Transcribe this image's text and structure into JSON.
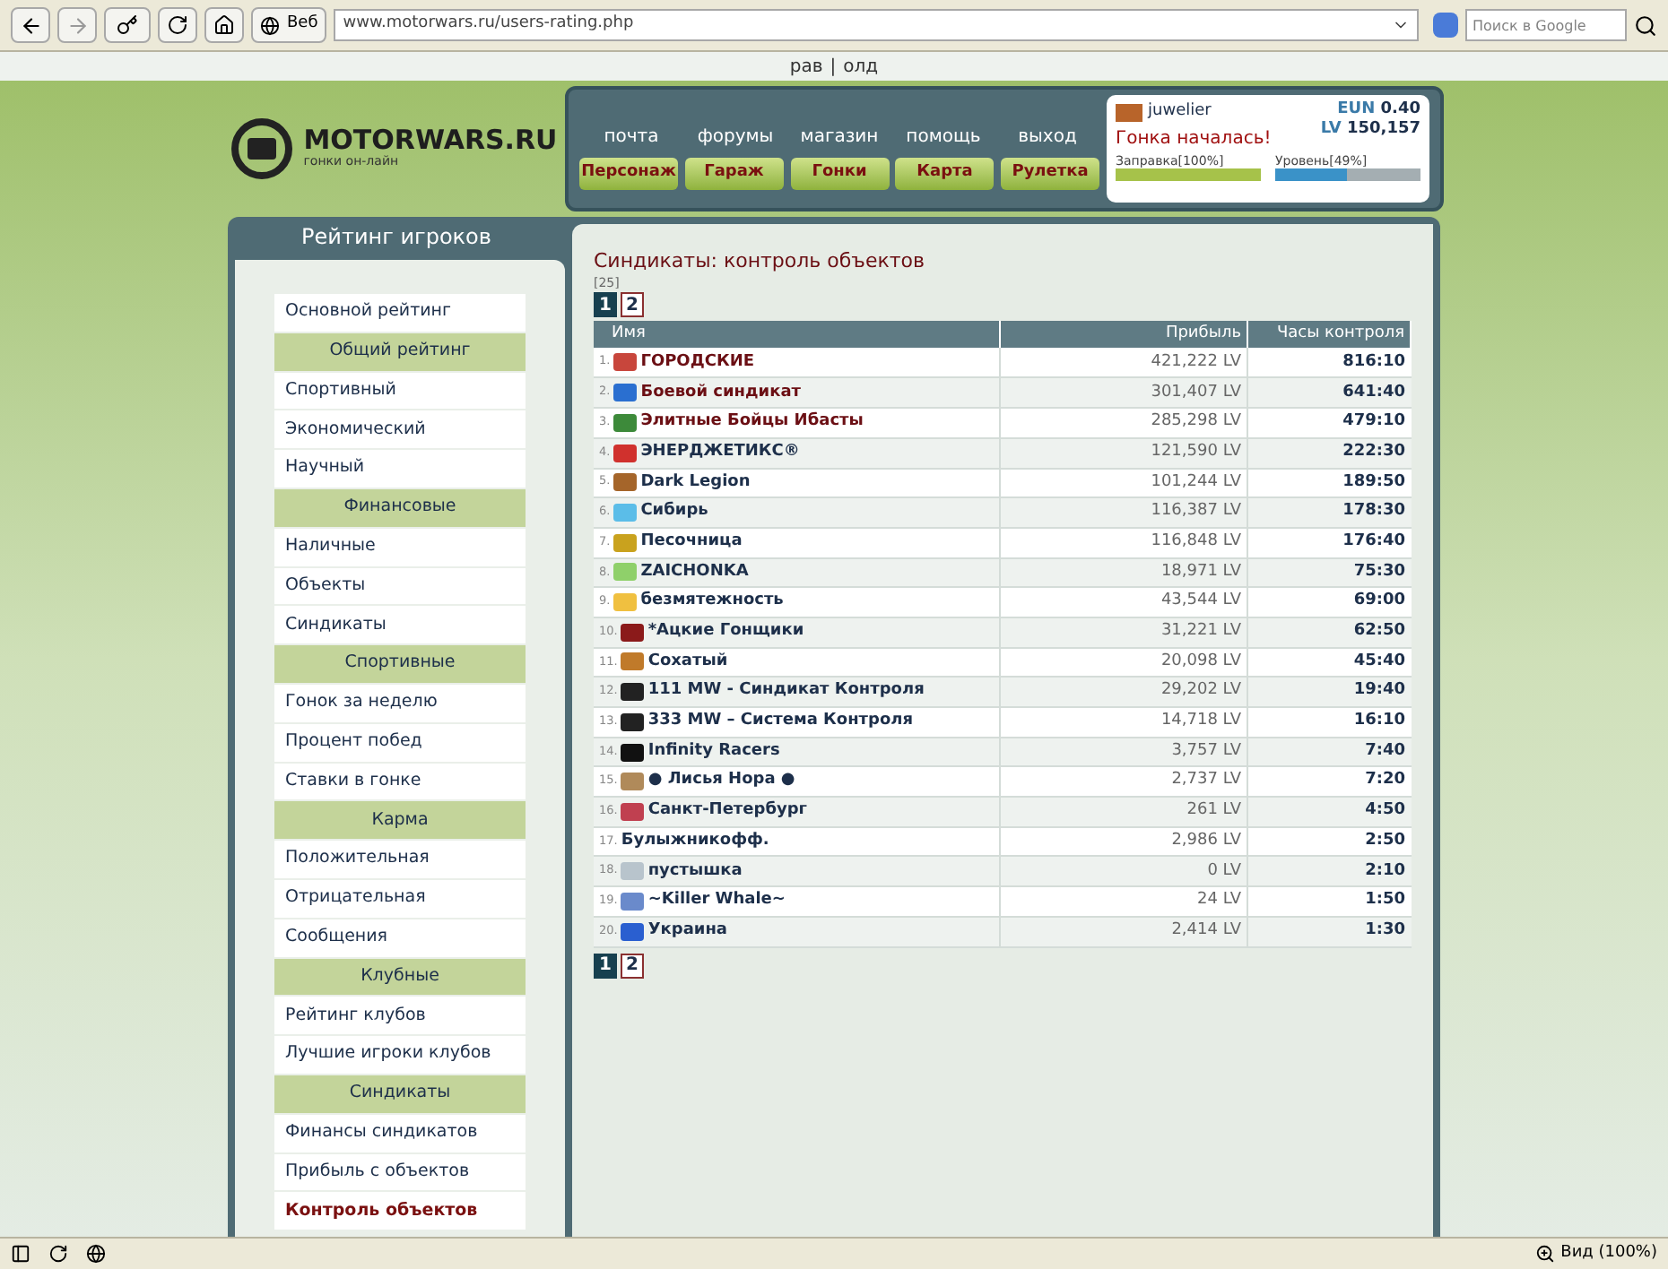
{
  "browser": {
    "tab_label": "Веб",
    "url": "www.motorwars.ru/users-rating.php",
    "search_placeholder": "Поиск в Google",
    "zoom": "Вид (100%)"
  },
  "top_links": [
    "рав",
    "олд"
  ],
  "top_separator": "|",
  "logo": {
    "name": "MOTORWARS.RU",
    "tagline": "гонки он-лайн"
  },
  "nav_links": [
    "почта",
    "форумы",
    "магазин",
    "помощь",
    "выход"
  ],
  "nav_buttons": [
    "Персонаж",
    "Гараж",
    "Гонки",
    "Карта",
    "Рулетка"
  ],
  "user": {
    "name": "juwelier",
    "status": "Гонка началась!",
    "currencies": [
      {
        "unit": "EUN",
        "amount": "0.40"
      },
      {
        "unit": "LV",
        "amount": "150,157"
      }
    ],
    "bars": [
      {
        "label": "Заправка[100%]",
        "level": 1.0,
        "kind": "fuel"
      },
      {
        "label": "Уровень[49%]",
        "level": 0.49,
        "kind": "xp"
      }
    ]
  },
  "sidebar": {
    "title": "Рейтинг игроков",
    "items": [
      {
        "kind": "link",
        "label": "Основной рейтинг",
        "selected": false
      },
      {
        "kind": "header",
        "label": "Общий рейтинг"
      },
      {
        "kind": "link",
        "label": "Спортивный",
        "selected": false
      },
      {
        "kind": "link",
        "label": "Экономический",
        "selected": false
      },
      {
        "kind": "link",
        "label": "Научный",
        "selected": false
      },
      {
        "kind": "header",
        "label": "Финансовые"
      },
      {
        "kind": "link",
        "label": "Наличные",
        "selected": false
      },
      {
        "kind": "link",
        "label": "Объекты",
        "selected": false
      },
      {
        "kind": "link",
        "label": "Синдикаты",
        "selected": false
      },
      {
        "kind": "header",
        "label": "Спортивные"
      },
      {
        "kind": "link",
        "label": "Гонок за неделю",
        "selected": false
      },
      {
        "kind": "link",
        "label": "Процент побед",
        "selected": false
      },
      {
        "kind": "link",
        "label": "Ставки в гонке",
        "selected": false
      },
      {
        "kind": "header",
        "label": "Карма"
      },
      {
        "kind": "link",
        "label": "Положительная",
        "selected": false
      },
      {
        "kind": "link",
        "label": "Отрицательная",
        "selected": false
      },
      {
        "kind": "link",
        "label": "Сообщения",
        "selected": false
      },
      {
        "kind": "header",
        "label": "Клубные"
      },
      {
        "kind": "link",
        "label": "Рейтинг клубов",
        "selected": false
      },
      {
        "kind": "link",
        "label": "Лучшие игроки клубов",
        "selected": false
      },
      {
        "kind": "header",
        "label": "Синдикаты"
      },
      {
        "kind": "link",
        "label": "Финансы синдикатов",
        "selected": false
      },
      {
        "kind": "link",
        "label": "Прибыль с объектов",
        "selected": false
      },
      {
        "kind": "link",
        "label": "Контроль объектов",
        "selected": true
      }
    ]
  },
  "content": {
    "title": "Синдикаты: контроль объектов",
    "count": "[25]",
    "pages_top": [
      {
        "label": "1",
        "selected": true
      },
      {
        "label": "2",
        "selected": false
      }
    ],
    "table": {
      "columns": [
        "Имя",
        "Прибыль",
        "Часы контроля"
      ],
      "rows": [
        {
          "rank": "1.",
          "name": "ГОРОДСКИЕ",
          "profit": "421,222 LV",
          "hours": "816:10",
          "highlighted": true,
          "color": "#c8463c"
        },
        {
          "rank": "2.",
          "name": "Боевой синдикат",
          "profit": "301,407 LV",
          "hours": "641:40",
          "highlighted": true,
          "color": "#2a6fd0"
        },
        {
          "rank": "3.",
          "name": "Элитные Бойцы Ибасты",
          "profit": "285,298 LV",
          "hours": "479:10",
          "highlighted": true,
          "color": "#3d8a3a"
        },
        {
          "rank": "4.",
          "name": "ЭНЕРДЖЕТИКС®",
          "profit": "121,590 LV",
          "hours": "222:30",
          "highlighted": false,
          "color": "#d0312d"
        },
        {
          "rank": "5.",
          "name": "Dark Legion",
          "profit": "101,244 LV",
          "hours": "189:50",
          "highlighted": false,
          "color": "#a5652a"
        },
        {
          "rank": "6.",
          "name": "Сибирь",
          "profit": "116,387 LV",
          "hours": "178:30",
          "highlighted": false,
          "color": "#5bbde8"
        },
        {
          "rank": "7.",
          "name": "Песочница",
          "profit": "116,848 LV",
          "hours": "176:40",
          "highlighted": false,
          "color": "#c9a21e"
        },
        {
          "rank": "8.",
          "name": "ZAICHONKA",
          "profit": "18,971 LV",
          "hours": "75:30",
          "highlighted": false,
          "color": "#8fd06a"
        },
        {
          "rank": "9.",
          "name": "безмятежность",
          "profit": "43,544 LV",
          "hours": "69:00",
          "highlighted": false,
          "color": "#f0c040"
        },
        {
          "rank": "10.",
          "name": "*Ацкие Гонщики",
          "profit": "31,221 LV",
          "hours": "62:50",
          "highlighted": false,
          "color": "#8b1a1a"
        },
        {
          "rank": "11.",
          "name": "Сохатый",
          "profit": "20,098 LV",
          "hours": "45:40",
          "highlighted": false,
          "color": "#c07a2a"
        },
        {
          "rank": "12.",
          "name": "111 MW - Синдикат Контроля",
          "profit": "29,202 LV",
          "hours": "19:40",
          "highlighted": false,
          "color": "#222222"
        },
        {
          "rank": "13.",
          "name": "333 MW – Система Контроля",
          "profit": "14,718 LV",
          "hours": "16:10",
          "highlighted": false,
          "color": "#222222"
        },
        {
          "rank": "14.",
          "name": "Infinity Racers",
          "profit": "3,757 LV",
          "hours": "7:40",
          "highlighted": false,
          "color": "#111111"
        },
        {
          "rank": "15.",
          "name": "● Лисья Нора ●",
          "profit": "2,737 LV",
          "hours": "7:20",
          "highlighted": false,
          "color": "#b08a5a"
        },
        {
          "rank": "16.",
          "name": "Санкт-Петербург",
          "profit": "261 LV",
          "hours": "4:50",
          "highlighted": false,
          "color": "#c04050"
        },
        {
          "rank": "17.",
          "name": "Булыжникофф.",
          "profit": "2,986 LV",
          "hours": "2:50",
          "highlighted": false
        },
        {
          "rank": "18.",
          "name": "пустышка",
          "profit": "0 LV",
          "hours": "2:10",
          "highlighted": false,
          "color": "#b8c4cc"
        },
        {
          "rank": "19.",
          "name": "~Killer Whale~",
          "profit": "24 LV",
          "hours": "1:50",
          "highlighted": false,
          "color": "#6a8acb"
        },
        {
          "rank": "20.",
          "name": "Украина",
          "profit": "2,414 LV",
          "hours": "1:30",
          "highlighted": false,
          "color": "#2a5fd0"
        }
      ]
    },
    "pages_bottom": [
      {
        "label": "1",
        "selected": true
      },
      {
        "label": "2",
        "selected": false
      }
    ]
  }
}
